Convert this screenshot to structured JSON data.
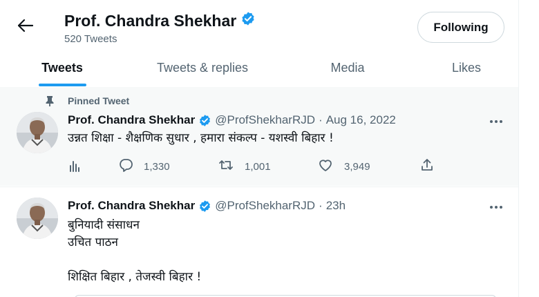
{
  "header": {
    "profile_name": "Prof. Chandra Shekhar",
    "tweet_count": "520 Tweets",
    "following_label": "Following"
  },
  "tabs": [
    {
      "label": "Tweets",
      "active": true
    },
    {
      "label": "Tweets & replies",
      "active": false
    },
    {
      "label": "Media",
      "active": false
    },
    {
      "label": "Likes",
      "active": false
    }
  ],
  "colors": {
    "accent": "#1d9bf0",
    "text_primary": "#0f1419",
    "text_secondary": "#536471",
    "pinned_bg": "#f7f9f9"
  },
  "icons": {
    "back": "arrow-left-icon",
    "verified": "verified-badge-icon",
    "pin": "pin-icon",
    "more": "more-dots-icon",
    "views": "views-bars-icon",
    "reply": "reply-bubble-icon",
    "retweet": "retweet-icon",
    "like": "heart-icon",
    "share": "share-upload-icon"
  },
  "tweets": [
    {
      "pinned_label": "Pinned Tweet",
      "author_name": "Prof. Chandra Shekhar",
      "handle": "@ProfShekharRJD",
      "separator": "·",
      "time": "Aug 16, 2022",
      "text_lines": [
        "उन्नत शिक्षा - शैक्षणिक सुधार , हमारा संकल्प - यशस्वी बिहार !"
      ],
      "replies": "1,330",
      "retweets": "1,001",
      "likes": "3,949"
    },
    {
      "author_name": "Prof. Chandra Shekhar",
      "handle": "@ProfShekharRJD",
      "separator": "·",
      "time": "23h",
      "text_lines": [
        "बुनियादी संसाधन",
        "उचित पाठन",
        "",
        "शिक्षित बिहार , तेजस्वी बिहार !"
      ]
    }
  ]
}
